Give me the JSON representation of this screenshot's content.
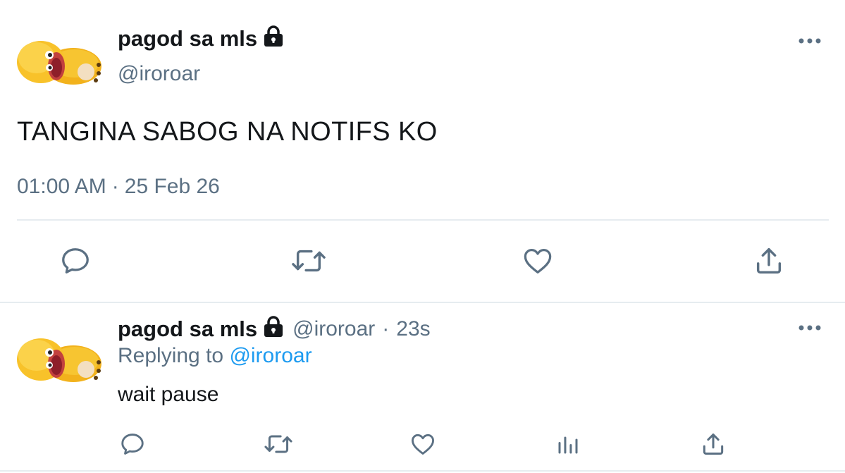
{
  "main_tweet": {
    "display_name": "pagod sa mls",
    "handle": "@iroroar",
    "text": "TANGINA SABOG NA NOTIFS KO",
    "time": "01:00 AM",
    "separator": "·",
    "date": "25 Feb 26"
  },
  "reply": {
    "display_name": "pagod sa mls",
    "handle": "@iroroar",
    "separator": "·",
    "age": "23s",
    "replying_prefix": "Replying to",
    "replying_to": "@iroroar",
    "text": "wait pause"
  },
  "icons": {
    "more": "more-horizontal-icon",
    "reply": "speech-bubble-icon",
    "retweet": "retweet-icon",
    "like": "heart-icon",
    "share": "share-icon",
    "analytics": "bar-chart-icon",
    "lock": "lock-icon"
  },
  "colors": {
    "primary_text": "#14171a",
    "secondary_text": "#5b7083",
    "link": "#1d9bf0",
    "divider": "#e6ecf0"
  }
}
